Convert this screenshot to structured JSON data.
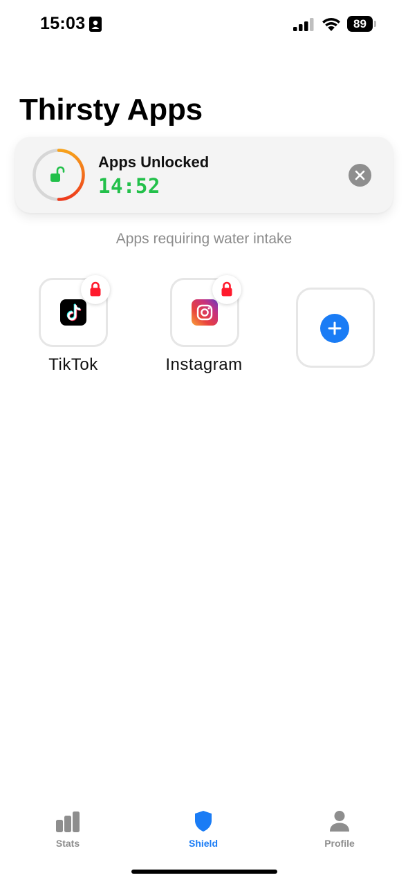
{
  "status_bar": {
    "time": "15:03",
    "battery": "89",
    "icons": [
      "id-card-icon",
      "signal-icon",
      "wifi-icon",
      "battery-icon"
    ]
  },
  "page": {
    "title": "Thirsty Apps"
  },
  "unlock_card": {
    "title": "Apps Unlocked",
    "timer": "14:52",
    "ring_progress": 0.5,
    "colors": {
      "timer": "#22c04a",
      "ring_start": "#f7a21b",
      "ring_end": "#ee3a1c",
      "ring_track": "#d6d6d6"
    },
    "icons": [
      "unlocked-padlock-icon",
      "close-icon"
    ]
  },
  "section": {
    "subtitle": "Apps requiring water intake"
  },
  "apps": [
    {
      "label": "TikTok",
      "icon": "tiktok-icon",
      "locked": true
    },
    {
      "label": "Instagram",
      "icon": "instagram-icon",
      "locked": true
    }
  ],
  "add_app": {
    "icon": "plus-icon",
    "color": "#1a7cf5"
  },
  "tab_bar": {
    "accent": "#1a7cf5",
    "inactive": "#8e8e8e",
    "tabs": [
      {
        "label": "Stats",
        "icon": "bar-chart-icon",
        "active": false
      },
      {
        "label": "Shield",
        "icon": "shield-icon",
        "active": true
      },
      {
        "label": "Profile",
        "icon": "person-icon",
        "active": false
      }
    ]
  }
}
